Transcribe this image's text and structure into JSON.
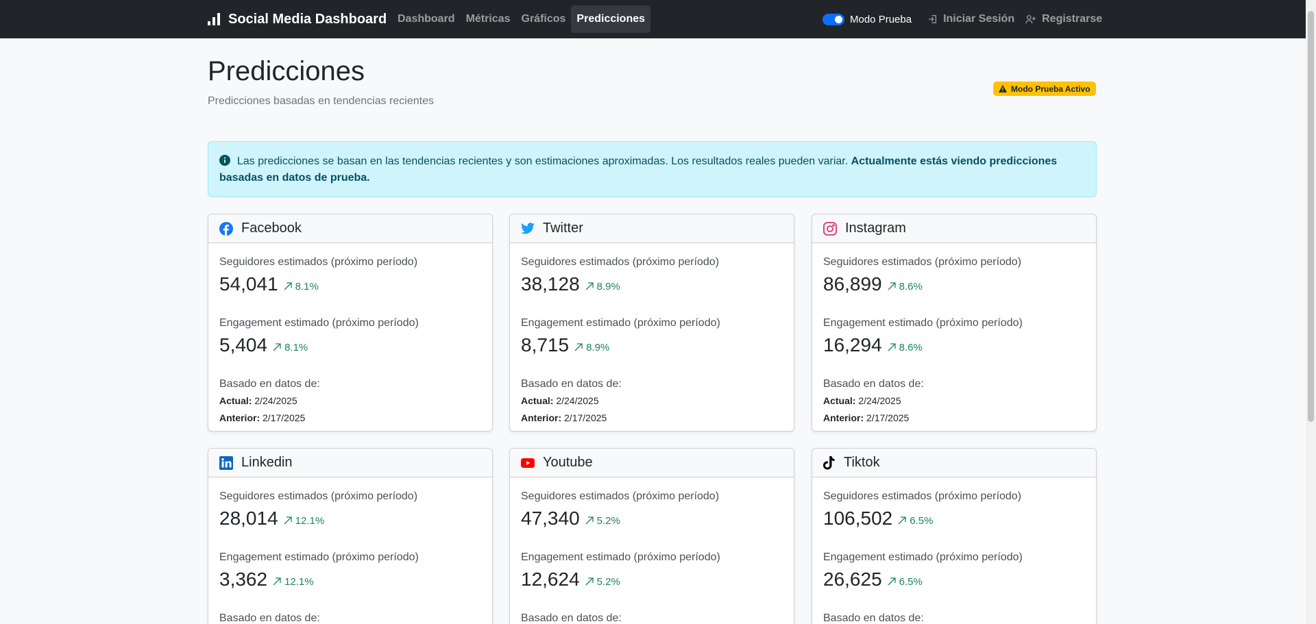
{
  "navbar": {
    "brand": "Social Media Dashboard",
    "links": [
      {
        "label": "Dashboard",
        "active": false
      },
      {
        "label": "Métricas",
        "active": false
      },
      {
        "label": "Gráficos",
        "active": false
      },
      {
        "label": "Predicciones",
        "active": true
      }
    ],
    "toggle_label": "Modo Prueba",
    "login": "Iniciar Sesión",
    "register": "Registrarse"
  },
  "header": {
    "title": "Predicciones",
    "subtitle": "Predicciones basadas en tendencias recientes",
    "badge": "Modo Prueba Activo"
  },
  "alert": {
    "text": "Las predicciones se basan en las tendencias recientes y son estimaciones aproximadas. Los resultados reales pueden variar.",
    "bold": "Actualmente estás viendo predicciones basadas en datos de prueba."
  },
  "labels": {
    "followers": "Seguidores estimados (próximo período)",
    "engagement": "Engagement estimado (próximo período)",
    "based_on": "Basado en datos de:",
    "current": "Actual:",
    "previous": "Anterior:"
  },
  "platforms": [
    {
      "name": "Facebook",
      "color": "#1877f2",
      "followers": "54,041",
      "followers_change": "8.1%",
      "engagement": "5,404",
      "engagement_change": "8.1%",
      "current_date": "2/24/2025",
      "previous_date": "2/17/2025"
    },
    {
      "name": "Twitter",
      "color": "#1da1f2",
      "followers": "38,128",
      "followers_change": "8.9%",
      "engagement": "8,715",
      "engagement_change": "8.9%",
      "current_date": "2/24/2025",
      "previous_date": "2/17/2025"
    },
    {
      "name": "Instagram",
      "color": "#e1306c",
      "followers": "86,899",
      "followers_change": "8.6%",
      "engagement": "16,294",
      "engagement_change": "8.6%",
      "current_date": "2/24/2025",
      "previous_date": "2/17/2025"
    },
    {
      "name": "Linkedin",
      "color": "#0a66c2",
      "followers": "28,014",
      "followers_change": "12.1%",
      "engagement": "3,362",
      "engagement_change": "12.1%"
    },
    {
      "name": "Youtube",
      "color": "#ff0000",
      "followers": "47,340",
      "followers_change": "5.2%",
      "engagement": "12,624",
      "engagement_change": "5.2%"
    },
    {
      "name": "Tiktok",
      "color": "#000000",
      "followers": "106,502",
      "followers_change": "6.5%",
      "engagement": "26,625",
      "engagement_change": "6.5%"
    }
  ]
}
